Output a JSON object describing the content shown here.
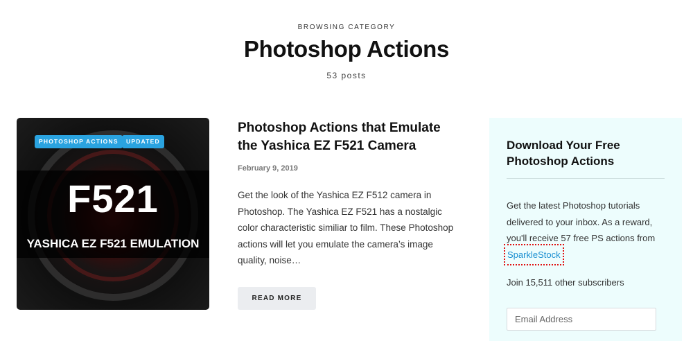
{
  "category": {
    "eyebrow": "BROWSING CATEGORY",
    "title": "Photoshop Actions",
    "count": "53 posts"
  },
  "post": {
    "badges": [
      "PHOTOSHOP ACTIONS",
      "UPDATED"
    ],
    "thumbnail": {
      "big_text": "F521",
      "sub_text": "YASHICA EZ F521 EMULATION"
    },
    "title": "Photoshop Actions that Emulate the Yashica EZ F521 Camera",
    "date": "February 9, 2019",
    "excerpt": "Get the look of the Yashica EZ F512 camera in Photoshop. The Yashica EZ F521 has a nostalgic color characteristic similiar to film. These Photoshop actions will let you emulate the camera’s image quality, noise…",
    "read_more": "READ MORE"
  },
  "sidebar": {
    "title": "Download Your Free Photoshop Actions",
    "text_before_link": "Get the latest Photoshop tutorials delivered to your inbox. As a reward, you'll receive 57 free PS actions from ",
    "link_text": "SparkleStock",
    "subscribers": "Join 15,511 other subscribers",
    "email_placeholder": "Email Address"
  },
  "colors": {
    "badge": "#2aa3e0",
    "sidebar_bg": "#edfdfd",
    "link": "#1a8fd1"
  }
}
